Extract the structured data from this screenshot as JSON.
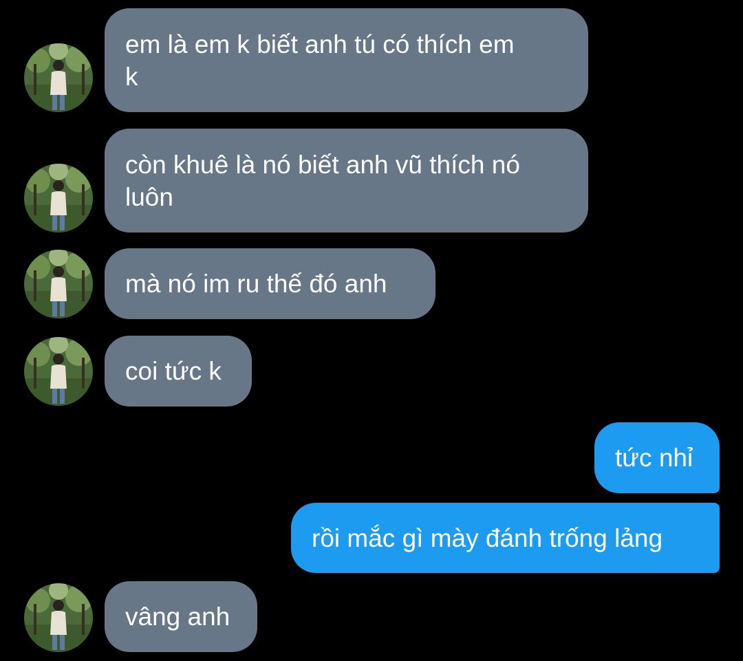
{
  "colors": {
    "background": "#000000",
    "incoming_bubble": "#677788",
    "outgoing_bubble": "#1d9bf0",
    "text": "#ffffff"
  },
  "messages": [
    {
      "direction": "incoming",
      "text": "em là em k biết anh tú có thích em\nk",
      "avatar": "profile-photo"
    },
    {
      "direction": "incoming",
      "text": "còn khuê là nó biết anh vũ thích nó\nluôn",
      "avatar": "profile-photo"
    },
    {
      "direction": "incoming",
      "text": "mà nó im ru thế đó anh",
      "avatar": "profile-photo"
    },
    {
      "direction": "incoming",
      "text": "coi tức k",
      "avatar": "profile-photo"
    },
    {
      "direction": "outgoing",
      "text": "tức nhỉ"
    },
    {
      "direction": "outgoing",
      "text": "rồi mắc gì mày đánh trống lảng"
    },
    {
      "direction": "incoming",
      "text": "vâng anh",
      "avatar": "profile-photo"
    }
  ]
}
